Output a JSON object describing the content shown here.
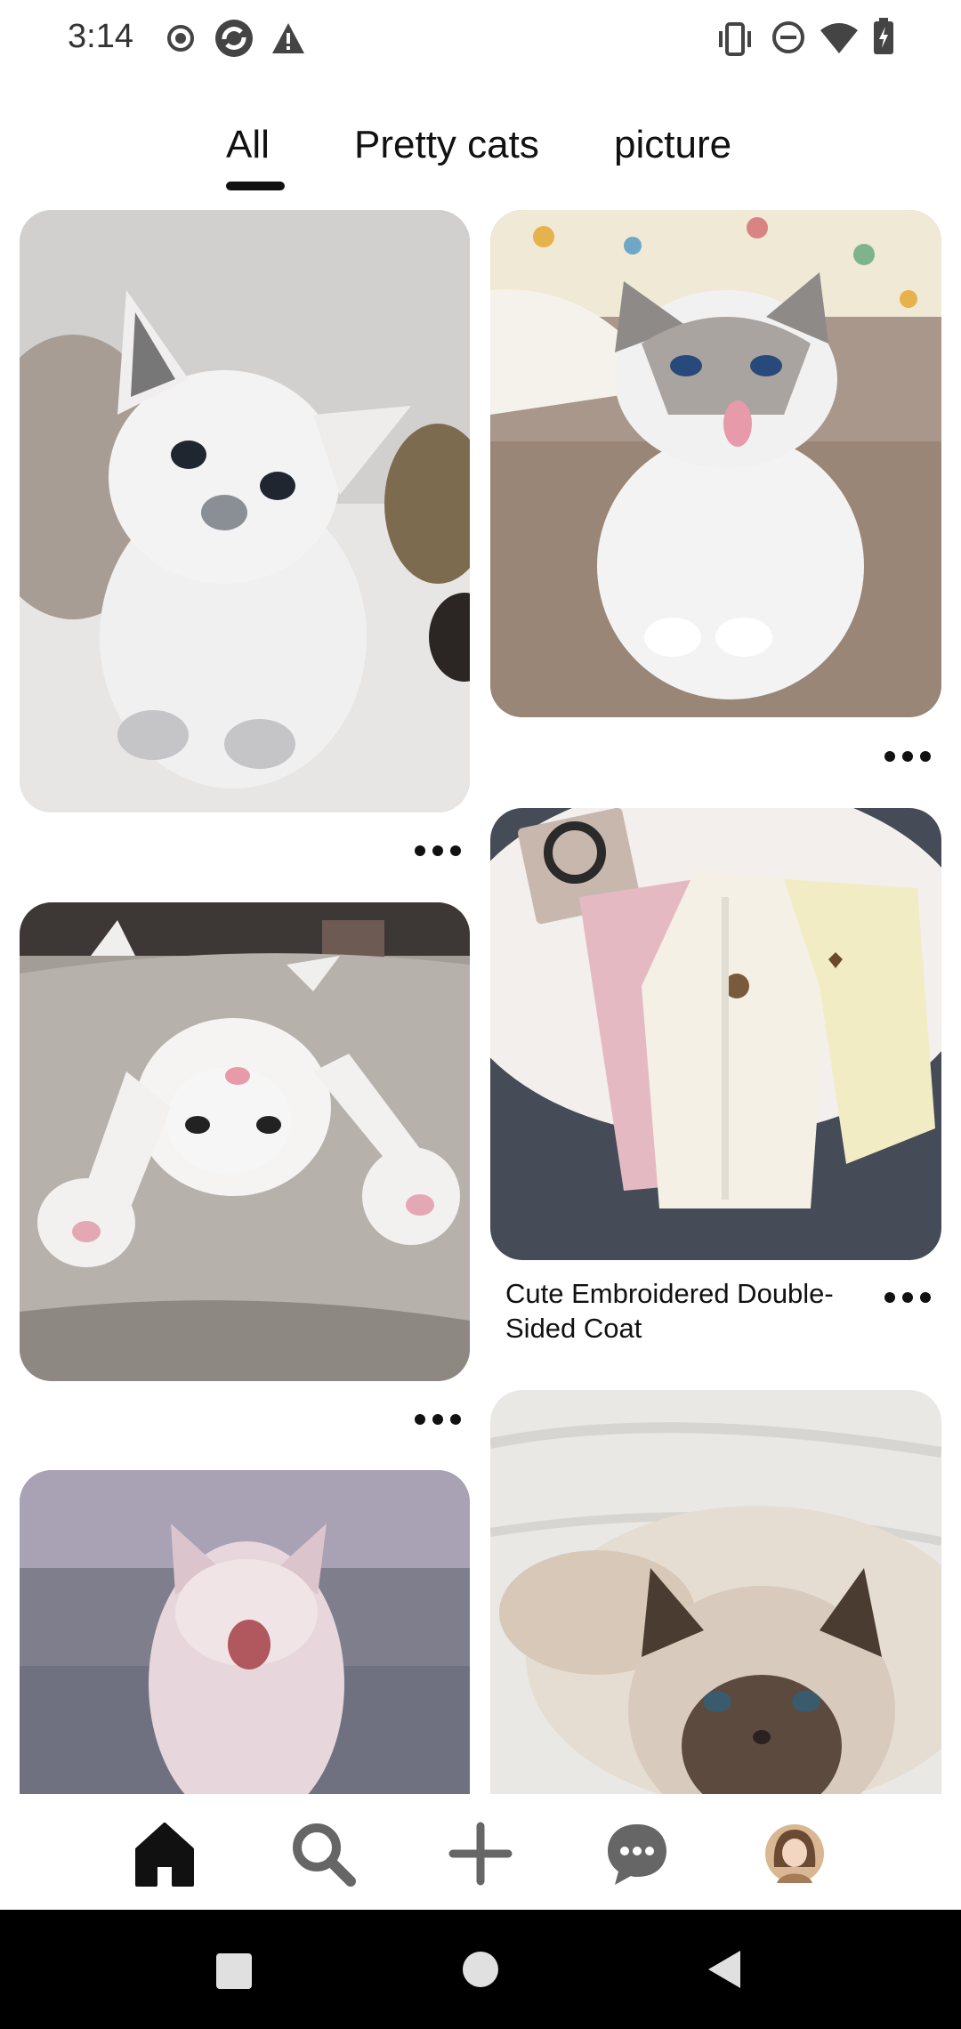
{
  "status_bar": {
    "time": "3:14",
    "left_icons": [
      "record-icon",
      "sync-app-icon",
      "warning-icon"
    ],
    "right_icons": [
      "vibrate-icon",
      "do-not-disturb-icon",
      "wifi-icon",
      "battery-charging-icon"
    ]
  },
  "tabs": [
    {
      "label": "All",
      "selected": true
    },
    {
      "label": "Pretty cats",
      "selected": false
    },
    {
      "label": "picture",
      "selected": false
    }
  ],
  "feed": {
    "pins": [
      {
        "id": "pin-1",
        "subject": "white fluffy kitten sitting",
        "caption": ""
      },
      {
        "id": "pin-2",
        "subject": "ragdoll cat sticking out tongue",
        "caption": ""
      },
      {
        "id": "pin-3",
        "subject": "white kitten lying upside down",
        "caption": ""
      },
      {
        "id": "pin-4",
        "subject": "cream fleece coats",
        "caption": "Cute Embroidered Double-Sided Coat"
      },
      {
        "id": "pin-5",
        "subject": "yawning kitten on couch",
        "caption": ""
      },
      {
        "id": "pin-6",
        "subject": "siamese cat on bed",
        "caption": ""
      }
    ],
    "more_icon": "more-horizontal-icon"
  },
  "bottom_nav": {
    "items": [
      {
        "name": "home",
        "icon": "home-icon",
        "active": true
      },
      {
        "name": "search",
        "icon": "search-icon",
        "active": false
      },
      {
        "name": "create",
        "icon": "plus-icon",
        "active": false
      },
      {
        "name": "messages",
        "icon": "chat-bubble-icon",
        "active": false
      },
      {
        "name": "profile",
        "icon": "avatar-icon",
        "active": false
      }
    ]
  },
  "system_nav": [
    "recents-button",
    "home-button",
    "back-button"
  ]
}
